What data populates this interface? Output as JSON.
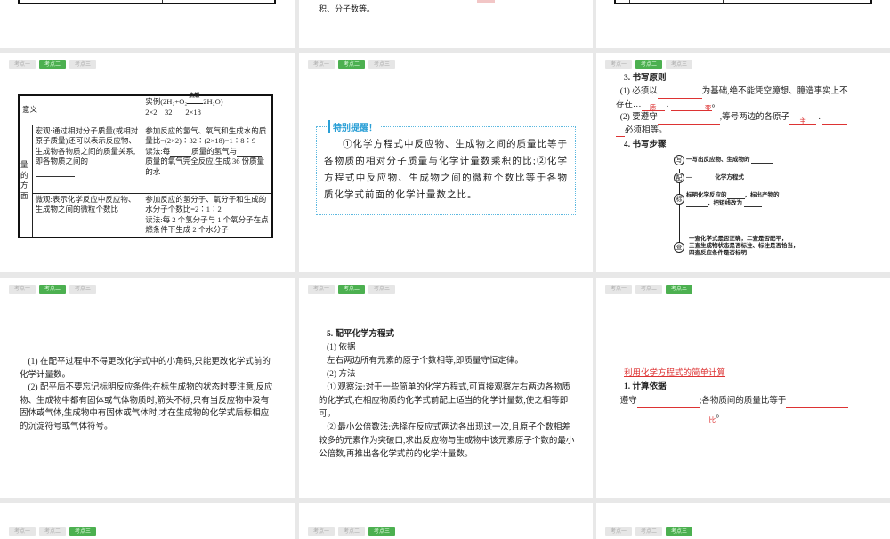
{
  "tabs": [
    "考点一",
    "考点二",
    "考点三"
  ],
  "top_middle_text": "积、分子数等。",
  "slide_table": {
    "h1": "意义",
    "h2": "实例(2H₂+O₂",
    "cond": "点燃",
    "h2b": "2H₂O)",
    "h2c": "2×2    32       2×18",
    "side": "量的方面",
    "macro": "宏观:通过相对分子质量(或相对原子质量)还可以表示反应物、生成物各物质之间的质量关系,即各物质之间的",
    "macro_ex1": "参加反应的氢气、氧气和生成水的质量比=(2×2)∶32∶(2×18)=1∶8∶9",
    "macro_ex2a": "读法:每",
    "macro_ex2b": "质量的氢气与",
    "macro_ex2c": "质量的氧气完全反应,生成 36 份质量的水",
    "micro": "微观:表示化学反应中反应物、生成物之间的微粒个数比",
    "micro_ex": "参加反应的氢分子、氧分子和生成的水分子个数比=2∶1∶2",
    "micro_ex2": "读法:每 2 个氢分子与 1 个氧分子在点燃条件下生成 2 个水分子"
  },
  "tip": {
    "title": "特别提醒！",
    "body": "①化学方程式中反应物、生成物之间的质量比等于各物质的相对分子质量与化学计量数乘积的比;②化学方程式中反应物、生成物之间的微粒个数比等于各物质化学式前面的化学计量数之比。"
  },
  "principles": {
    "title": "3. 书写原则",
    "p1a": "(1) 必须以",
    "p1b": "为基础,绝不能凭空臆想、臆造事实上不",
    "p1c": "存在",
    "p1d": "质",
    "p1e": "变",
    "p1f": "。",
    "p2a": "(2) 要遵守",
    "p2b": ",等号两边的各原子",
    "p2c": "主",
    "p2d": "必须相等。",
    "steps_title": "4. 书写步骤",
    "steps": [
      {
        "icon": "写",
        "text": "一写出反应物、生成物的"
      },
      {
        "icon": "配",
        "text": "化学方程式"
      },
      {
        "icon": "标",
        "text": "标明化学反应的",
        "text2": "，标出产物的",
        "text3": "，把短线改为"
      },
      {
        "icon": "查",
        "text": "一查化学式是否正确，二查是否配平，",
        "text2": "三查生成物状态是否标注、标注是否恰当，",
        "text3": "四查反应条件是否标明"
      }
    ]
  },
  "notes": {
    "n1": "(1) 在配平过程中不得更改化学式中的小角码,只能更改化学式前的化学计量数。",
    "n2": "(2) 配平后不要忘记标明反应条件;在标生成物的状态时要注意,反应物、生成物中都有固体或气体物质时,箭头不标,只有当反应物中没有固体或气体,生成物中有固体或气体时,才在生成物的化学式后标相应的沉淀符号或气体符号。"
  },
  "balance": {
    "title": "5. 配平化学方程式",
    "s1": "(1) 依据",
    "s1t": "左右两边所有元素的原子个数相等,即质量守恒定律。",
    "s2": "(2) 方法",
    "m1": "① 观察法:对于一些简单的化学方程式,可直接观察左右两边各物质的化学式,在相应物质的化学式前配上适当的化学计量数,使之相等即可。",
    "m2": "② 最小公倍数法:选择在反应式两边各出现过一次,且原子个数相差较多的元素作为突破口,求出反应物与生成物中该元素原子个数的最小公倍数,再推出各化学式前的化学计量数。"
  },
  "calc": {
    "title": "利用化学方程式的简单计算",
    "sub": "1. 计算依据",
    "a": "遵守",
    "b": ";各物质间的质量比等于",
    "c": "比",
    "d": "。"
  },
  "colors": {
    "active_tab": "#4cb050",
    "accent_red": "#d33",
    "tip_blue": "#2a9fd6"
  }
}
